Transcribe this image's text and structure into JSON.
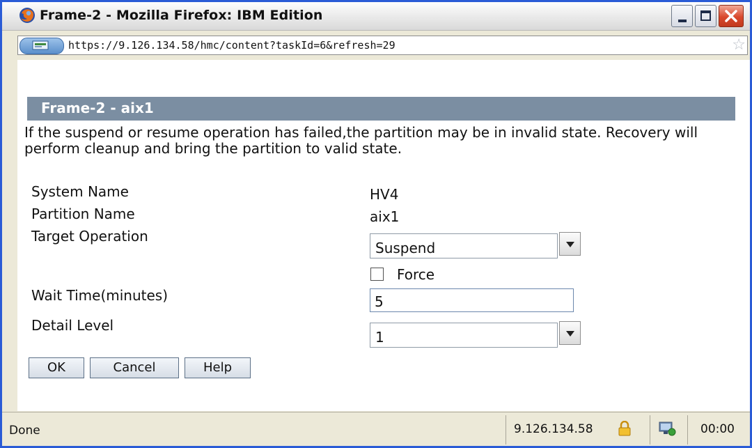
{
  "window": {
    "title": "Frame-2 - Mozilla Firefox: IBM Edition",
    "controls": [
      "minimize",
      "maximize",
      "close"
    ]
  },
  "addressbar": {
    "url": "https://9.126.134.58/hmc/content?taskId=6&refresh=29"
  },
  "panel": {
    "title": "Frame-2 - aix1",
    "description": " If the suspend or resume operation has failed,the partition may be in invalid state. Recovery will perform cleanup and bring the partition to valid state.",
    "fields": {
      "system_name_label": "System Name",
      "system_name_value": "HV4",
      "partition_name_label": "Partition Name",
      "partition_name_value": "aix1",
      "target_operation_label": "Target Operation",
      "target_operation_value": "Suspend",
      "force_label": "Force",
      "force_checked": false,
      "wait_time_label": "Wait Time(minutes)",
      "wait_time_value": "5",
      "detail_level_label": "Detail Level",
      "detail_level_value": "1"
    },
    "buttons": {
      "ok": "OK",
      "cancel": "Cancel",
      "help": "Help"
    }
  },
  "statusbar": {
    "status": "Done",
    "host": "9.126.134.58",
    "time": "00:00"
  },
  "colors": {
    "panel_header": "#7b8ea2",
    "window_frame": "#2a5bd6",
    "chrome": "#ece9d8"
  }
}
